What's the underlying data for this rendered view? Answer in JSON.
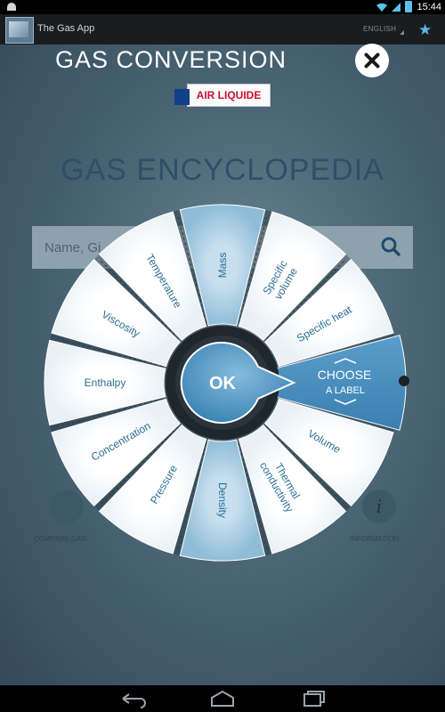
{
  "status_bar": {
    "time": "15:44"
  },
  "action_bar": {
    "app_title": "The Gas App",
    "language": "ENGLISH"
  },
  "background": {
    "title": "GAS ENCYCLOPEDIA",
    "search_placeholder": "Name, Gi",
    "compare_label": "COMPARE GAS",
    "info_label": "INFORMATION",
    "info_glyph": "i"
  },
  "dialog": {
    "title": "GAS CONVERSION",
    "brand": "AIR LIQUIDE",
    "ok_label": "OK",
    "choose_line1": "CHOOSE",
    "choose_line2": "A LABEL",
    "segments": [
      {
        "label": "Mass"
      },
      {
        "label": "Specific volume"
      },
      {
        "label": "Specific heat"
      },
      {
        "label": "Volume"
      },
      {
        "label": "Thermal conductivity"
      },
      {
        "label": "Density"
      },
      {
        "label": "Pressure"
      },
      {
        "label": "Concentration"
      },
      {
        "label": "Enthalpy"
      },
      {
        "label": "Viscosity"
      },
      {
        "label": "Temperature"
      }
    ]
  },
  "colors": {
    "wheel_text": "#2b6f94",
    "accent": "#3a86b8",
    "highlight": "#a9cde3"
  },
  "icons": [
    "android-icon",
    "wifi-icon",
    "signal-icon",
    "battery-icon",
    "star-icon",
    "close-icon",
    "search-icon",
    "back-icon",
    "home-icon",
    "recent-apps-icon"
  ]
}
